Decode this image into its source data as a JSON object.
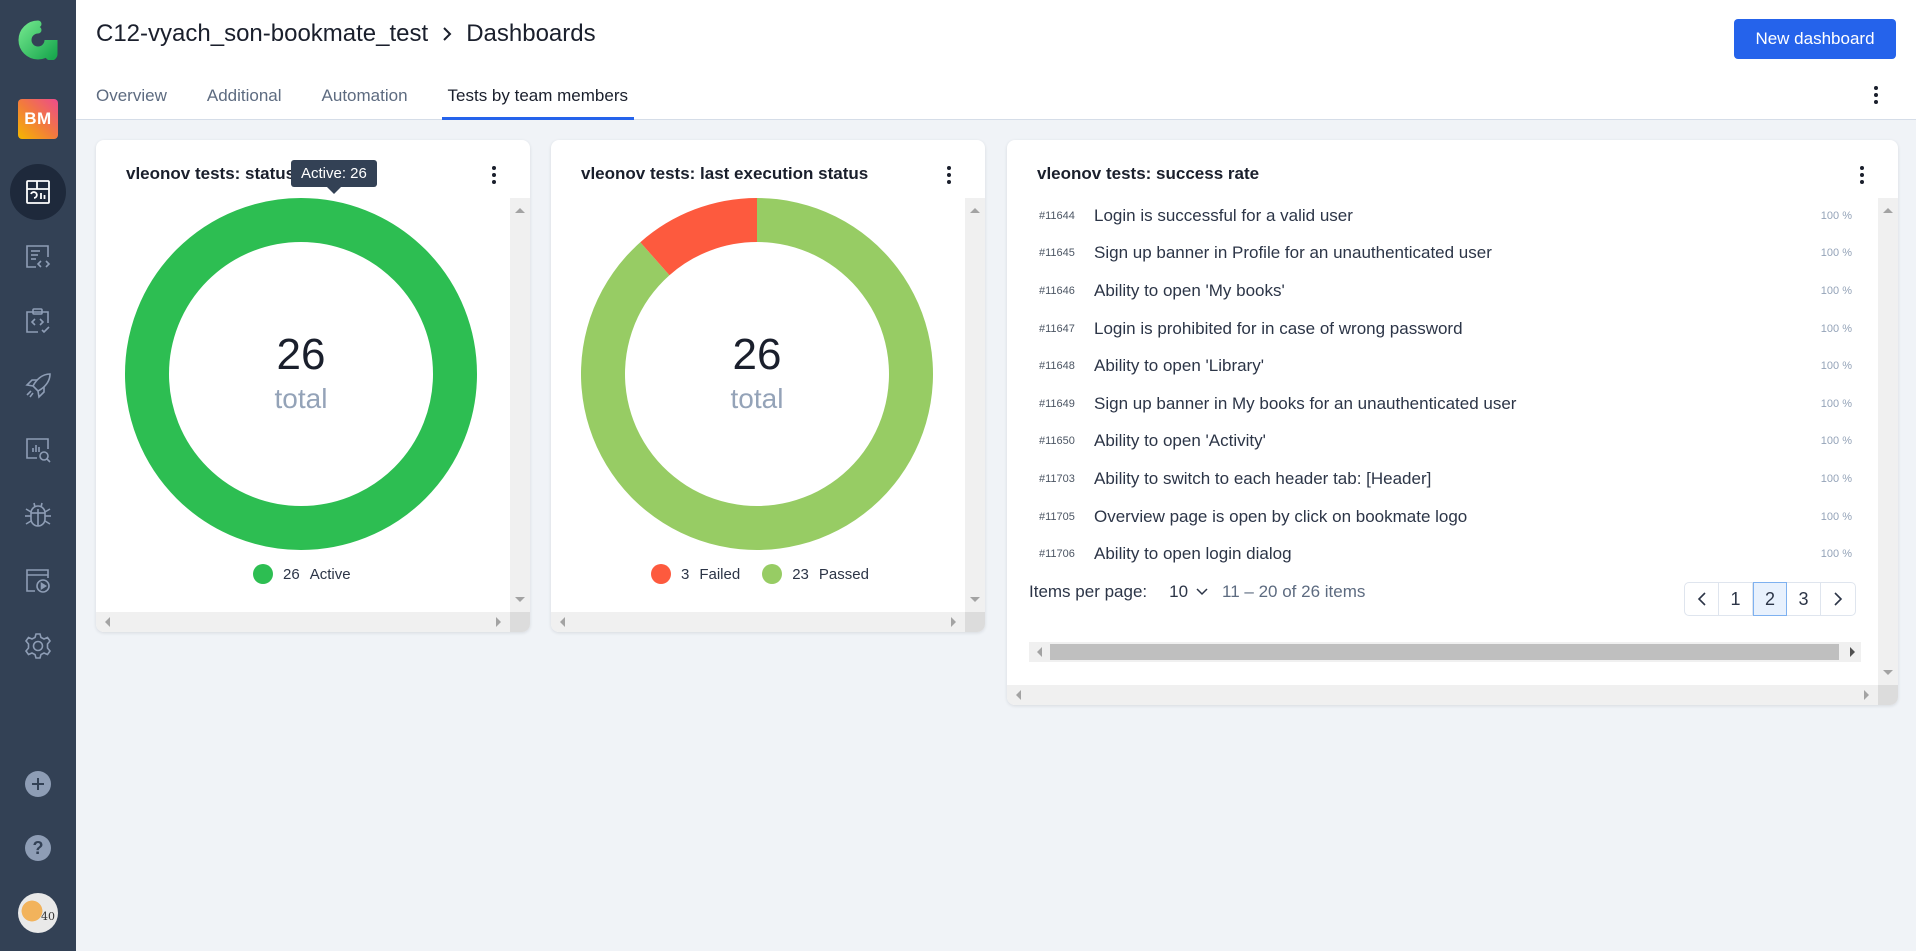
{
  "sidebar": {
    "logo": "allure-logo",
    "project_badge": "BM",
    "items": [
      {
        "name": "dashboards",
        "icon": "dashboard-icon",
        "active": true
      },
      {
        "name": "test-cases",
        "icon": "test-cases-icon",
        "active": false
      },
      {
        "name": "test-plans",
        "icon": "test-plans-icon",
        "active": false
      },
      {
        "name": "launches",
        "icon": "rocket-icon",
        "active": false
      },
      {
        "name": "analytics",
        "icon": "analytics-icon",
        "active": false
      },
      {
        "name": "defects",
        "icon": "bug-icon",
        "active": false
      },
      {
        "name": "jobs",
        "icon": "jobs-icon",
        "active": false
      },
      {
        "name": "settings",
        "icon": "gear-icon",
        "active": false
      }
    ],
    "bottom": [
      {
        "name": "create",
        "icon": "plus-icon"
      },
      {
        "name": "help",
        "icon": "help-icon"
      },
      {
        "name": "profile",
        "icon": "avatar",
        "badge_text": "40"
      }
    ]
  },
  "header": {
    "breadcrumb": {
      "project": "C12-vyach_son-bookmate_test",
      "separator": ">",
      "page": "Dashboards"
    },
    "new_dashboard_label": "New dashboard",
    "tabs": [
      {
        "label": "Overview",
        "active": false
      },
      {
        "label": "Additional",
        "active": false
      },
      {
        "label": "Automation",
        "active": false
      },
      {
        "label": "Tests by team members",
        "active": true
      }
    ]
  },
  "widgets": {
    "status": {
      "title": "vleonov tests: status",
      "tooltip": "Active: 26",
      "total": "26",
      "total_label": "total",
      "legend": [
        {
          "count": "26",
          "label": "Active",
          "color": "#2dbe52"
        }
      ]
    },
    "last_execution": {
      "title": "vleonov tests: last execution status",
      "total": "26",
      "total_label": "total",
      "legend": [
        {
          "count": "3",
          "label": "Failed",
          "color": "#fd5a3e"
        },
        {
          "count": "23",
          "label": "Passed",
          "color": "#97cc64"
        }
      ]
    },
    "success_rate": {
      "title": "vleonov tests: success rate",
      "rows": [
        {
          "id": "#11644",
          "name": "Login is successful for a valid user",
          "rate": "100 %"
        },
        {
          "id": "#11645",
          "name": "Sign up banner in Profile for an unauthenticated user",
          "rate": "100 %"
        },
        {
          "id": "#11646",
          "name": "Ability to open 'My books'",
          "rate": "100 %"
        },
        {
          "id": "#11647",
          "name": "Login is prohibited for in case of wrong password",
          "rate": "100 %"
        },
        {
          "id": "#11648",
          "name": "Ability to open 'Library'",
          "rate": "100 %"
        },
        {
          "id": "#11649",
          "name": "Sign up banner in My books for an unauthenticated user",
          "rate": "100 %"
        },
        {
          "id": "#11650",
          "name": "Ability to open 'Activity'",
          "rate": "100 %"
        },
        {
          "id": "#11703",
          "name": "Ability to switch to each header tab: [Header]",
          "rate": "100 %"
        },
        {
          "id": "#11705",
          "name": "Overview page is open by click on bookmate logo",
          "rate": "100 %"
        },
        {
          "id": "#11706",
          "name": "Ability to open login dialog",
          "rate": "100 %"
        }
      ],
      "pagination": {
        "items_per_page_label": "Items per page:",
        "items_per_page": "10",
        "range": "11 – 20 of 26 items",
        "pages": [
          "1",
          "2",
          "3"
        ],
        "current_page": "2",
        "prev_icon": "chevron-left-icon",
        "next_icon": "chevron-right-icon"
      }
    }
  },
  "chart_data": [
    {
      "type": "pie",
      "title": "vleonov tests: status",
      "categories": [
        "Active"
      ],
      "values": [
        26
      ],
      "colors": [
        "#2dbe52"
      ],
      "center_label": "26 total",
      "legend": "bottom"
    },
    {
      "type": "pie",
      "title": "vleonov tests: last execution status",
      "categories": [
        "Failed",
        "Passed"
      ],
      "values": [
        3,
        23
      ],
      "colors": [
        "#fd5a3e",
        "#97cc64"
      ],
      "center_label": "26 total",
      "legend": "bottom"
    }
  ]
}
